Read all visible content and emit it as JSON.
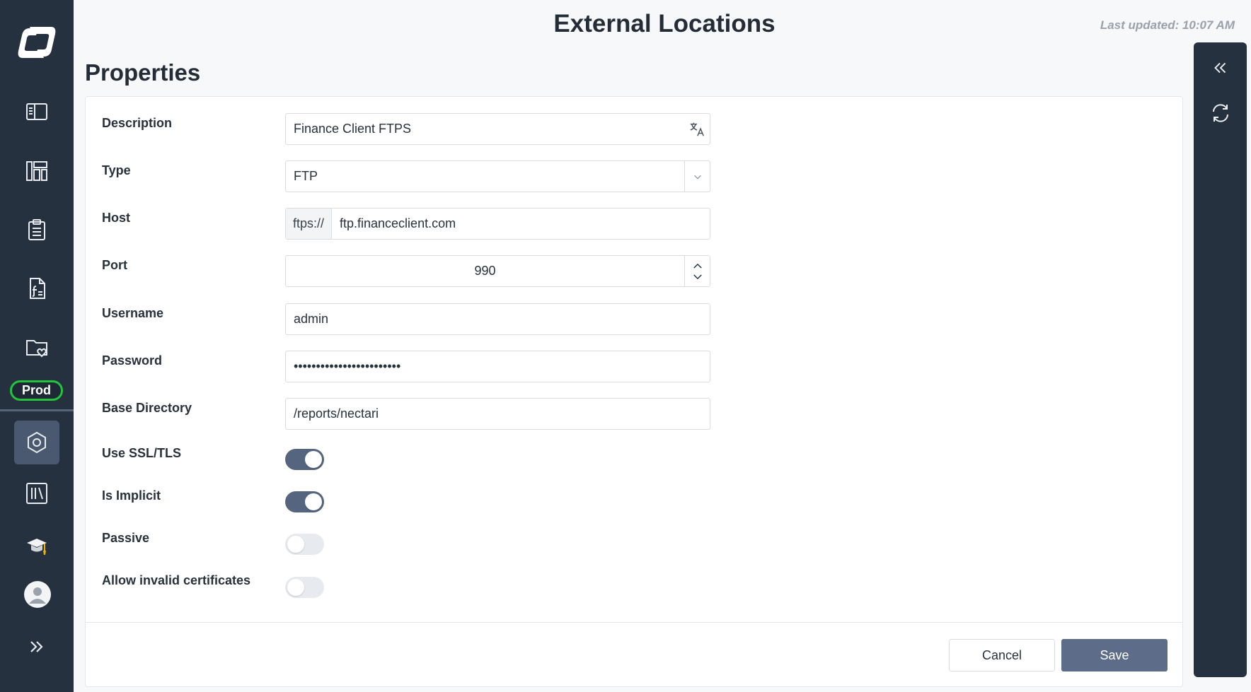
{
  "header": {
    "title": "External Locations",
    "last_updated": "Last updated: 10:07 AM"
  },
  "section_title": "Properties",
  "nav": {
    "items": [
      {
        "icon": "book-open-icon"
      },
      {
        "icon": "dashboard-icon"
      },
      {
        "icon": "clipboard-icon"
      },
      {
        "icon": "file-function-icon"
      },
      {
        "icon": "folder-heart-icon"
      },
      {
        "icon": "hexagon-settings-icon",
        "active": true
      },
      {
        "icon": "library-icon"
      },
      {
        "icon": "graduation-cap-icon"
      }
    ],
    "environment": "Prod",
    "expand_icon": "chevrons-right-icon"
  },
  "form": {
    "description": {
      "label": "Description",
      "value": "Finance Client FTPS",
      "icon": "translate-icon"
    },
    "type": {
      "label": "Type",
      "value": "FTP"
    },
    "host": {
      "label": "Host",
      "prefix": "ftps://",
      "value": "ftp.financeclient.com"
    },
    "port": {
      "label": "Port",
      "value": "990"
    },
    "username": {
      "label": "Username",
      "value": "admin"
    },
    "password": {
      "label": "Password",
      "value": "••••••••••••••••••••••••"
    },
    "base_directory": {
      "label": "Base Directory",
      "value": "/reports/nectari"
    },
    "use_ssl": {
      "label": "Use SSL/TLS",
      "on": true
    },
    "is_implicit": {
      "label": "Is Implicit",
      "on": true
    },
    "passive": {
      "label": "Passive",
      "on": false
    },
    "allow_invalid_certs": {
      "label": "Allow invalid certificates",
      "on": false
    }
  },
  "buttons": {
    "cancel": "Cancel",
    "save": "Save"
  },
  "rail": {
    "collapse_icon": "chevrons-left-icon",
    "refresh_icon": "refresh-icon"
  },
  "colors": {
    "nav_bg": "#25313f",
    "accent": "#55657f",
    "env_badge": "#21c43a"
  }
}
